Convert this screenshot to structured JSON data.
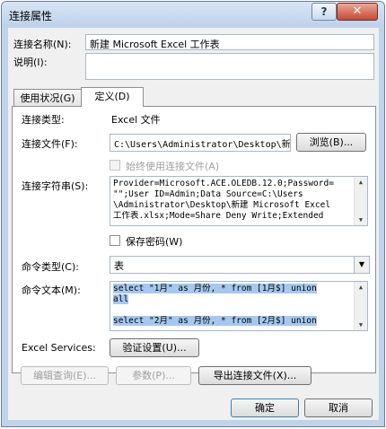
{
  "window": {
    "title": "连接属性",
    "help_label": "?",
    "close_label": "✕"
  },
  "conn_name_label": "连接名称(N):",
  "conn_name_value": "新建 Microsoft Excel 工作表",
  "desc_label": "说明(I):",
  "desc_value": "",
  "tabs": [
    {
      "label": "使用状况(G)"
    },
    {
      "label": "定义(D)"
    }
  ],
  "definition": {
    "conn_type_label": "连接类型:",
    "conn_type_value": "Excel 文件",
    "conn_file_label": "连接文件(F):",
    "conn_file_value": "C:\\Users\\Administrator\\Desktop\\新",
    "browse_label": "浏览(B)...",
    "always_use_label": "始终使用连接文件(A)",
    "conn_string_label": "连接字符串(S):",
    "conn_string_lines": [
      "Provider=Microsoft.ACE.OLEDB.12.0;Password=",
      "\"\";User ID=Admin;Data Source=C:\\Users",
      "\\Administrator\\Desktop\\新建 Microsoft Excel",
      "工作表.xlsx;Mode=Share Deny Write;Extended"
    ],
    "save_password_label": "保存密码(W)",
    "cmd_type_label": "命令类型(C):",
    "cmd_type_value": "表",
    "cmd_text_label": "命令文本(M):",
    "cmd_text_lines": [
      "select \"1月\" as 月份, * from [1月$] union",
      "all",
      "",
      "select \"2月\" as 月份, * from [2月$] union"
    ],
    "excel_services_label": "Excel Services:",
    "auth_settings_label": "验证设置(U)...",
    "edit_query_label": "编辑查询(E)...",
    "params_label": "参数(P)...",
    "export_label": "导出连接文件(X)..."
  },
  "footer": {
    "ok_label": "确定",
    "cancel_label": "取消"
  }
}
